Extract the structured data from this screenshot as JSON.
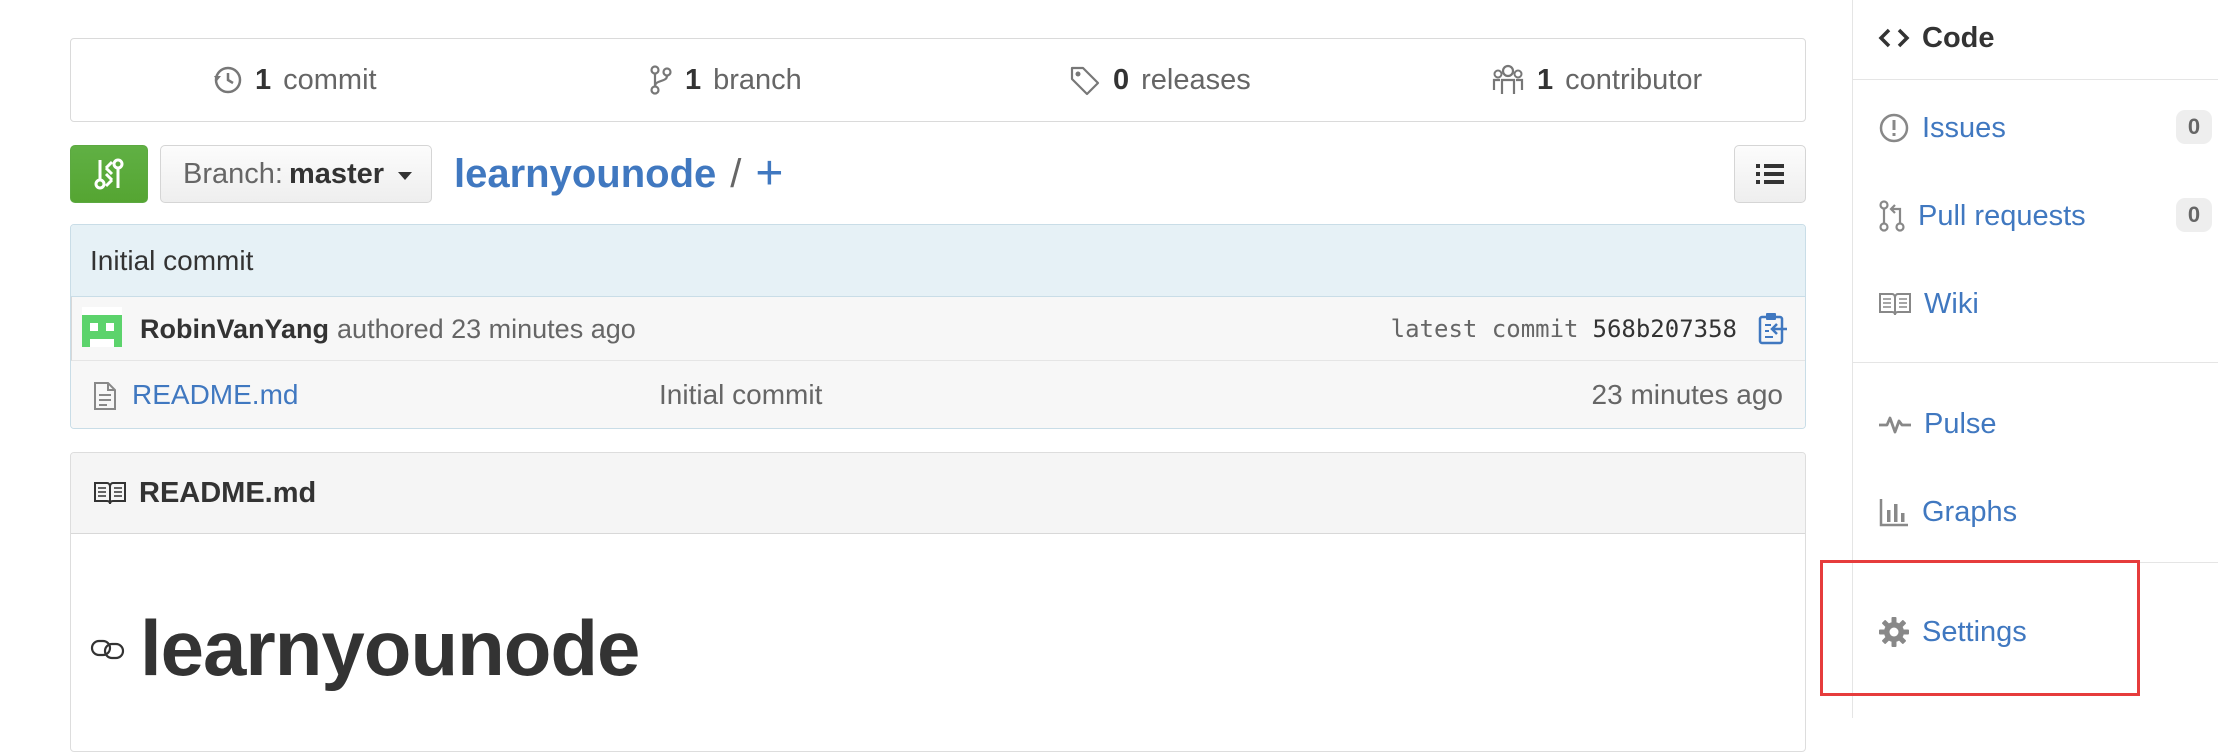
{
  "summary": {
    "commits": {
      "count": "1",
      "label": "commit"
    },
    "branches": {
      "count": "1",
      "label": "branch"
    },
    "releases": {
      "count": "0",
      "label": "releases"
    },
    "contributors": {
      "count": "1",
      "label": "contributor"
    }
  },
  "file_nav": {
    "branch_prefix": "Branch:",
    "branch_name": "master",
    "repo_name": "learnyounode",
    "separator": "/",
    "add_symbol": "+"
  },
  "commit_tease": {
    "message": "Initial commit",
    "author": "RobinVanYang",
    "authored_text": "authored 23 minutes ago",
    "latest_label": "latest commit",
    "sha": "568b207358"
  },
  "files": [
    {
      "name": "README.md",
      "message": "Initial commit",
      "age": "23 minutes ago",
      "icon": "file-text-icon"
    }
  ],
  "readme": {
    "filename": "README.md",
    "heading": "learnyounode"
  },
  "sidebar": {
    "items": [
      {
        "label": "Code",
        "icon": "code-icon"
      },
      {
        "label": "Issues",
        "icon": "issue-opened-icon",
        "count": "0"
      },
      {
        "label": "Pull requests",
        "icon": "git-pull-request-icon",
        "count": "0"
      },
      {
        "label": "Wiki",
        "icon": "book-icon"
      },
      {
        "label": "Pulse",
        "icon": "pulse-icon"
      },
      {
        "label": "Graphs",
        "icon": "graph-icon"
      },
      {
        "label": "Settings",
        "icon": "gear-icon"
      }
    ]
  },
  "colors": {
    "link": "#4078c0",
    "green_button": "#55a532",
    "commit_header_bg": "#e6f1f6",
    "highlight": "#e63c3c"
  }
}
